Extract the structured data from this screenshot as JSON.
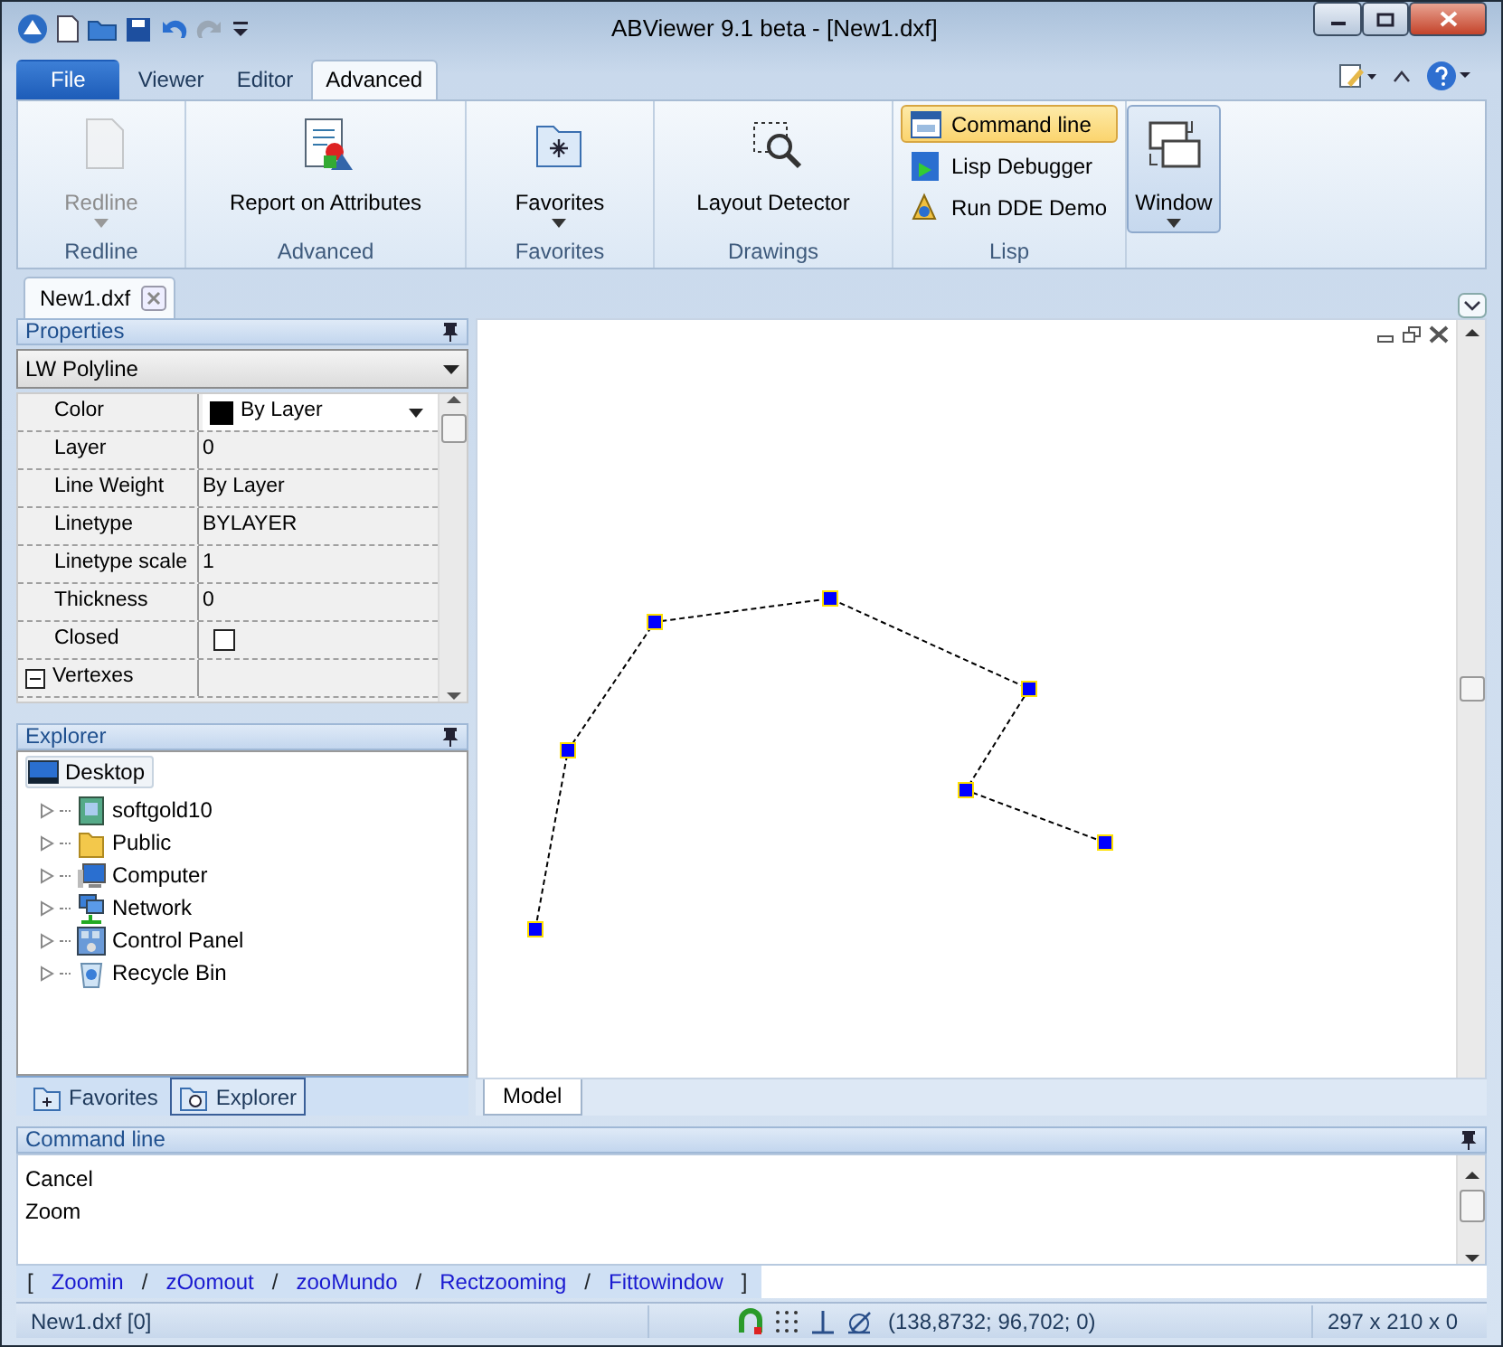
{
  "window": {
    "title": "ABViewer 9.1 beta - [New1.dxf]"
  },
  "ribbon_tabs": [
    {
      "label": "File",
      "kind": "file",
      "selected": false
    },
    {
      "label": "Viewer",
      "kind": "tab",
      "selected": false
    },
    {
      "label": "Editor",
      "kind": "tab",
      "selected": false
    },
    {
      "label": "Advanced",
      "kind": "tab",
      "selected": true
    }
  ],
  "ribbon_groups": [
    {
      "label": "Redline",
      "items": [
        {
          "label": "Redline",
          "kind": "large",
          "disabled": true,
          "dropdown": true,
          "pressed": false
        }
      ]
    },
    {
      "label": "Advanced",
      "items": [
        {
          "label": "Report on Attributes",
          "kind": "large",
          "disabled": false,
          "dropdown": false,
          "pressed": false
        }
      ]
    },
    {
      "label": "Favorites",
      "items": [
        {
          "label": "Favorites",
          "kind": "large",
          "disabled": false,
          "dropdown": true,
          "pressed": false
        }
      ]
    },
    {
      "label": "Drawings",
      "items": [
        {
          "label": "Layout Detector",
          "kind": "large",
          "disabled": false,
          "dropdown": false,
          "pressed": false
        }
      ]
    },
    {
      "label": "Lisp",
      "items": [
        {
          "label": "Command line",
          "kind": "small",
          "pressed": true
        },
        {
          "label": "Lisp Debugger",
          "kind": "small",
          "pressed": false
        },
        {
          "label": "Run DDE Demo",
          "kind": "small",
          "pressed": false
        }
      ]
    },
    {
      "items": [
        {
          "label": "Window",
          "kind": "large",
          "disabled": false,
          "dropdown": true,
          "pressed": true
        }
      ]
    }
  ],
  "document_tabs": [
    {
      "label": "New1.dxf",
      "selected": true
    }
  ],
  "properties": {
    "title": "Properties",
    "object_type": "LW Polyline",
    "rows": [
      {
        "name": "Color",
        "value": "By Layer",
        "kind": "color",
        "color": "#000000"
      },
      {
        "name": "Layer",
        "value": "0",
        "kind": "text"
      },
      {
        "name": "Line Weight",
        "value": "By Layer",
        "kind": "text"
      },
      {
        "name": "Linetype",
        "value": "BYLAYER",
        "kind": "text"
      },
      {
        "name": "Linetype scale",
        "value": "1",
        "kind": "text"
      },
      {
        "name": "Thickness",
        "value": "0",
        "kind": "text"
      },
      {
        "name": "Closed",
        "kind": "checkbox",
        "checked": false
      },
      {
        "name": "Vertexes",
        "kind": "group",
        "expanded": true
      }
    ]
  },
  "explorer": {
    "title": "Explorer",
    "root": {
      "label": "Desktop",
      "selected": true,
      "children": [
        {
          "label": "softgold10",
          "expanded": false
        },
        {
          "label": "Public",
          "expanded": false
        },
        {
          "label": "Computer",
          "expanded": false
        },
        {
          "label": "Network",
          "expanded": false
        },
        {
          "label": "Control Panel",
          "expanded": false
        },
        {
          "label": "Recycle Bin",
          "expanded": false
        }
      ]
    }
  },
  "panel_tabs": [
    {
      "label": "Favorites",
      "selected": false
    },
    {
      "label": "Explorer",
      "selected": true
    }
  ],
  "layout_tabs": [
    {
      "label": "Model",
      "selected": true
    }
  ],
  "command_line": {
    "title": "Command line",
    "history": [
      "Cancel",
      "Zoom"
    ],
    "prompt": {
      "open": "[",
      "separator": "/",
      "close": "]",
      "options": [
        "Zoomin",
        "zOomout",
        "zooMundo",
        "Rectzooming",
        "Fittowindow"
      ]
    }
  },
  "status_bar": {
    "file": "New1.dxf [0]",
    "coordinates": "(138,8732; 96,702; 0)",
    "paper": "297 x 210 x 0"
  }
}
